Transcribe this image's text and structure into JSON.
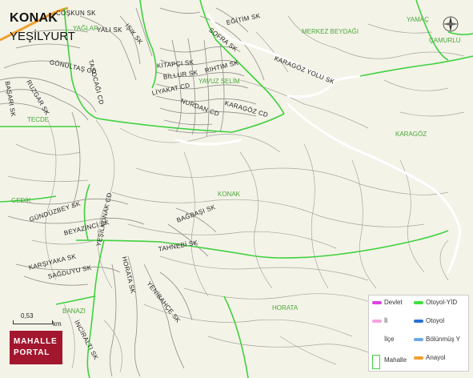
{
  "header": {
    "title": "KONAK",
    "subtitle": "YEŞİLYURT"
  },
  "streets": [
    "COŞKUN SK",
    "YALI SK",
    "IŞIK SK",
    "SOFRA SK",
    "EĞİTİM SK",
    "KARAGÖZ YOLU SK",
    "TAŞOCAĞI CD",
    "GÖNÜLTAŞ CD",
    "KİTAPÇI SK",
    "BİLLUR SK",
    "RIHTIM SK",
    "LİYAKAT CD",
    "NURDAN CD",
    "KARAGÖZ CD",
    "BAŞARI SK",
    "RUZGAR SK",
    "GÜNDÜZBEY SK",
    "BAĞBAŞI SK",
    "BEYAZİNCİ SK",
    "TAHNEBİ SK",
    "KARŞIYAKA SK",
    "SAĞDUYU SK",
    "YEŞİLKONAK CD",
    "HORATA SK",
    "YENİBAHÇE SK",
    "İNCİRALTI SK"
  ],
  "neighborhoods": [
    "MERKEZ BEYDAĞI",
    "YAMAÇ",
    "ÇAMURLU",
    "YAVUZ SELİM",
    "TECDE",
    "KARAGÖZ",
    "KONAK",
    "GEDİK",
    "HORATA",
    "BANAZI",
    "YAĞLAR"
  ],
  "scale": {
    "value": "0,53",
    "unit": "km"
  },
  "brand": {
    "line1": "MAHALLE",
    "line2": "PORTAL"
  },
  "legend": [
    {
      "label": "Devlet",
      "color": "#e040e0"
    },
    {
      "label": "Otoyol-YİD",
      "color": "#40e040"
    },
    {
      "label": "İl",
      "color": "#f5a3e0"
    },
    {
      "label": "Otoyol",
      "color": "#2a6fd6"
    },
    {
      "label": "İlçe",
      "color": ""
    },
    {
      "label": "Bölünmüş Y",
      "color": "#6aaae6"
    },
    {
      "label": "Mahalle",
      "color": "#3fd13f"
    },
    {
      "label": "Anayol",
      "color": "#f0a030"
    }
  ],
  "compass_icon": "compass-rose-icon"
}
